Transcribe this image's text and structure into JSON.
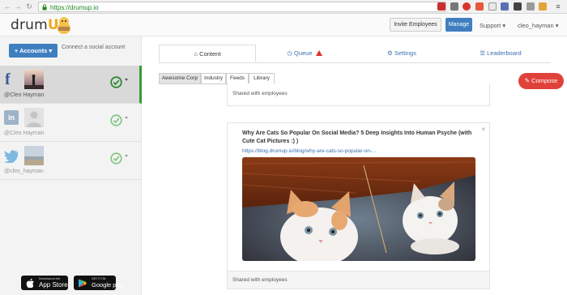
{
  "browser": {
    "url": "https://drumup.io",
    "star_icon": "star-icon"
  },
  "header": {
    "logo_prefix": "drum",
    "logo_accent": "Up",
    "invite_label": "Invite Employees",
    "manage_label": "Manage",
    "support_label": "Support ▾",
    "user_label": "cleo_hayman ▾"
  },
  "sidebar": {
    "accounts_button": "+ Accounts ▾",
    "connect_text": "Connect a social account",
    "accounts": [
      {
        "network": "facebook",
        "network_glyph": "f",
        "handle": "@Cleo Hayman"
      },
      {
        "network": "linkedin",
        "network_glyph": "in",
        "handle": "@Cleo Hayman"
      },
      {
        "network": "twitter",
        "network_glyph": "",
        "handle": "@cleo_hayman"
      }
    ],
    "app_store": {
      "small": "Download on the",
      "big": "App Store"
    },
    "google_play": {
      "small": "GET IT ON",
      "big": "Google play"
    }
  },
  "tabs": {
    "content": "Content",
    "queue": "Queue",
    "settings": "Settings",
    "leaderboard": "Leaderboard"
  },
  "subtabs": [
    "Awesome Corp",
    "Industry",
    "Feeds",
    "Library"
  ],
  "compose_label": "Compose",
  "feed": {
    "shared_label": "Shared with employees",
    "post_title": "Why Are Cats So Popular On Social Media? 5 Deep Insights Into Human Psyche (with Cute Cat Pictures :) )",
    "post_link": "https://blog.drumup.io/blog/why-are-cats-so-popular-on-...",
    "close_glyph": "×"
  },
  "colors": {
    "brand_blue": "#3f7fc0",
    "compose_red": "#e0423b",
    "active_green": "#3a9a3a",
    "logo_orange": "#f0a91f"
  }
}
